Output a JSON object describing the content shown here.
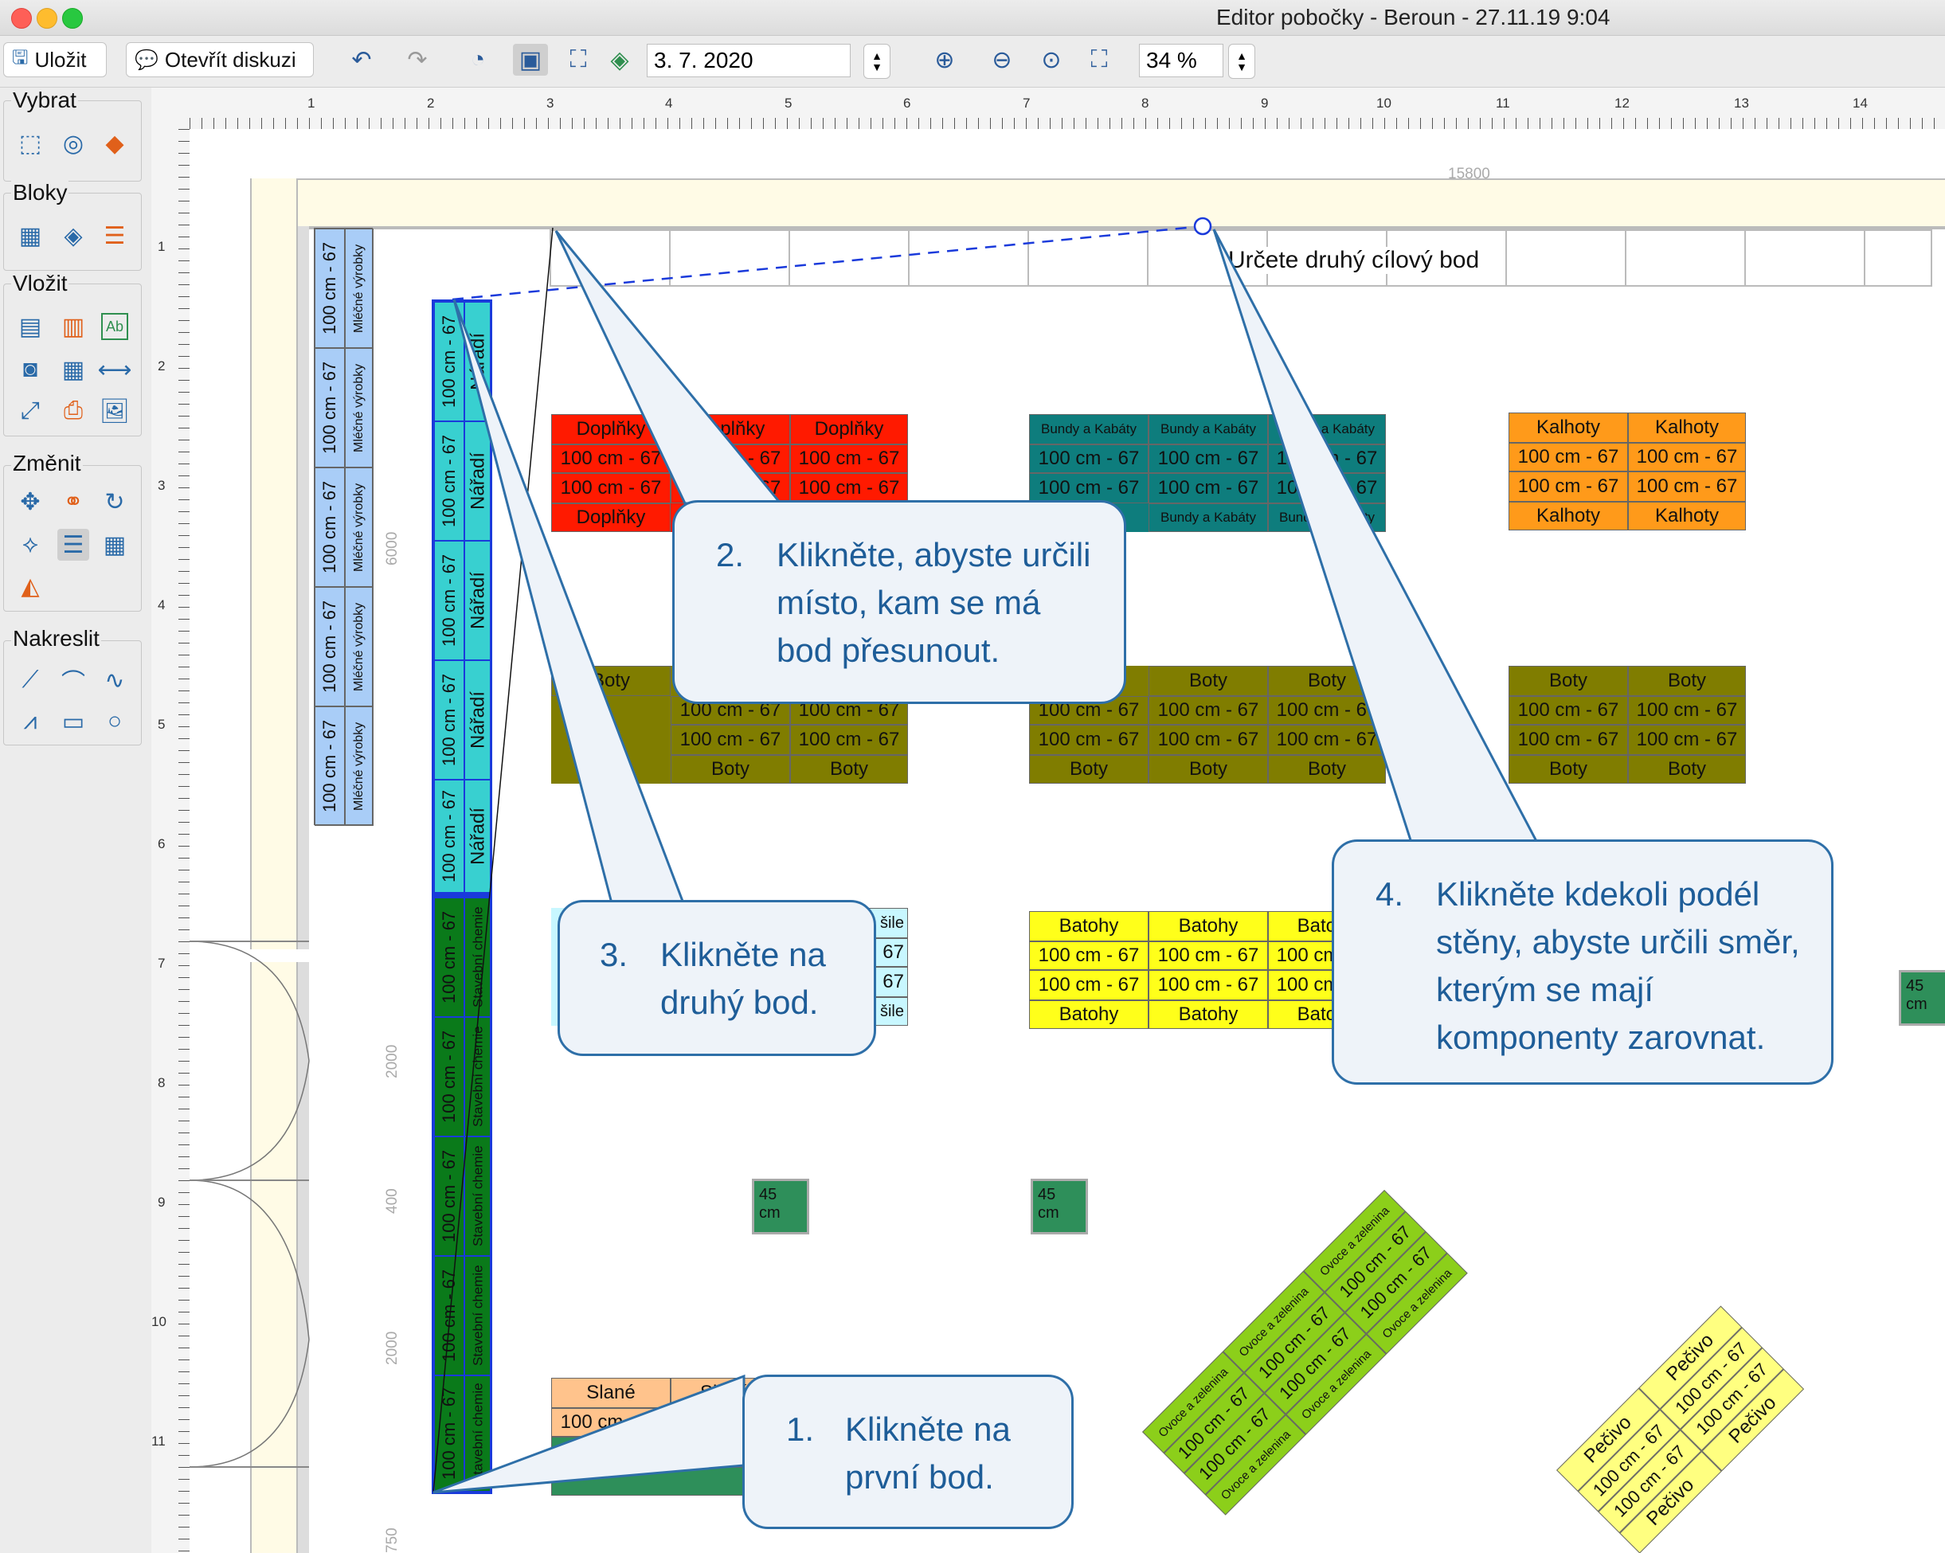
{
  "window": {
    "title": "Editor pobočky - Beroun - 27.11.19 9:04"
  },
  "toolbar": {
    "save_label": "Uložit",
    "open_discussion_label": "Otevřít diskuzi",
    "date_value": "3. 7. 2020",
    "zoom_value": "34 %"
  },
  "sidebar": {
    "select_title": "Vybrat",
    "blocks_title": "Bloky",
    "insert_title": "Vložit",
    "change_title": "Změnit",
    "draw_title": "Nakreslit"
  },
  "ruler": {
    "top": [
      "1",
      "2",
      "3",
      "4",
      "5",
      "6",
      "7",
      "8",
      "9",
      "10",
      "11",
      "12",
      "13",
      "14"
    ],
    "left": [
      "1",
      "2",
      "3",
      "4",
      "5",
      "6",
      "7",
      "8",
      "9",
      "10",
      "11"
    ]
  },
  "dimensions": {
    "top_width": "15800",
    "left_a": "6000",
    "left_b": "2000",
    "left_c": "400",
    "left_d": "2000",
    "left_e": "750"
  },
  "canvas": {
    "hint_text": "Určete druhý cílový bod",
    "dairy": {
      "label": "Mléčné výrobky",
      "size": "100 cm - 67"
    },
    "tools_col": {
      "label": "Nářadí",
      "size": "100 cm - 67"
    },
    "chem_col": {
      "label": "Stavební chemie",
      "size": "100 cm - 67"
    },
    "doplnky": {
      "label": "Doplňky",
      "size": "100 cm - 67"
    },
    "bundy": {
      "label": "Bundy a Kabáty",
      "size": "100 cm - 67"
    },
    "kalhoty": {
      "label": "Kalhoty",
      "size": "100 cm - 67"
    },
    "boty": {
      "label": "Boty",
      "size": "100 cm - 67"
    },
    "batohy": {
      "label": "Batohy",
      "size": "100 cm - 67"
    },
    "kosile": {
      "label": "šile",
      "size": "67"
    },
    "small": {
      "label": "45 cm"
    },
    "slane": {
      "label": "Slané",
      "size": "100 cm - 67"
    },
    "ovoce": {
      "label": "Ovoce a zelenina",
      "size": "100 cm - 67"
    },
    "pecivo": {
      "label": "Pečivo",
      "size": "100 cm - 67"
    }
  },
  "callouts": {
    "c1": {
      "num": "1.",
      "text": "Klikněte na první bod."
    },
    "c2": {
      "num": "2.",
      "text": "Klikněte, abyste určili místo, kam se má bod přesunout."
    },
    "c3": {
      "num": "3.",
      "text": "Klikněte na druhý bod."
    },
    "c4": {
      "num": "4.",
      "text": "Klikněte kdekoli podél stěny, abyste určili směr, kterým se mají komponenty zarovnat."
    }
  },
  "colors": {
    "red": "#ff1a00",
    "teal": "#0e7d7d",
    "orange": "#ff9a1a",
    "olive": "#807d00",
    "yellow": "#ffff1a",
    "cyan": "#38d0d0",
    "green": "#0a7a1a",
    "lime": "#8ccf1a",
    "peach": "#ffc38c",
    "pale_yellow": "#ffff80",
    "seagreen": "#2e8f5a",
    "callout_border": "#2e6fa8",
    "dairy_blue": "#a9cdf7"
  }
}
